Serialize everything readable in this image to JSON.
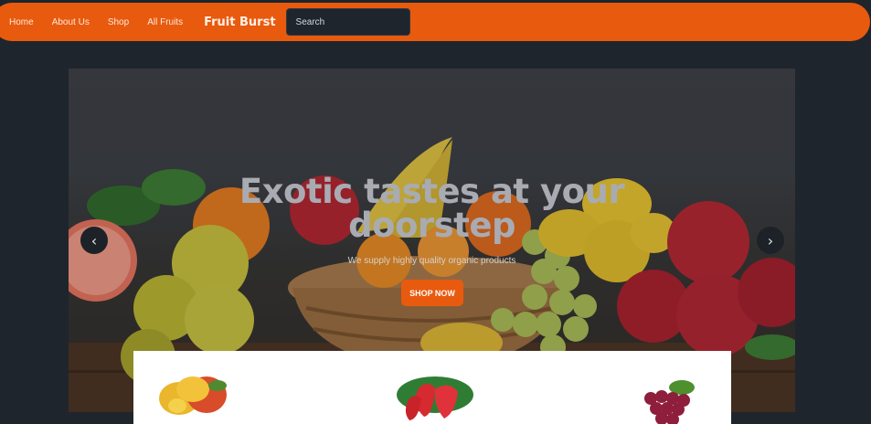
{
  "navbar": {
    "links": [
      "Home",
      "About Us",
      "Shop",
      "All Fruits"
    ],
    "brand": "Fruit Burst",
    "search_placeholder": "Search"
  },
  "hero": {
    "title": "Exotic tastes at your doorstep",
    "subtitle": "We supply highly quality organic products",
    "cta_label": "SHOP NOW",
    "prev_icon": "chevron-left-icon",
    "next_icon": "chevron-right-icon",
    "prev_glyph": "‹",
    "next_glyph": "›"
  },
  "featured": {
    "items": [
      "mango-image",
      "strawberry-image",
      "grapes-image"
    ]
  },
  "colors": {
    "accent": "#e85a0e",
    "background": "#1f252c"
  }
}
